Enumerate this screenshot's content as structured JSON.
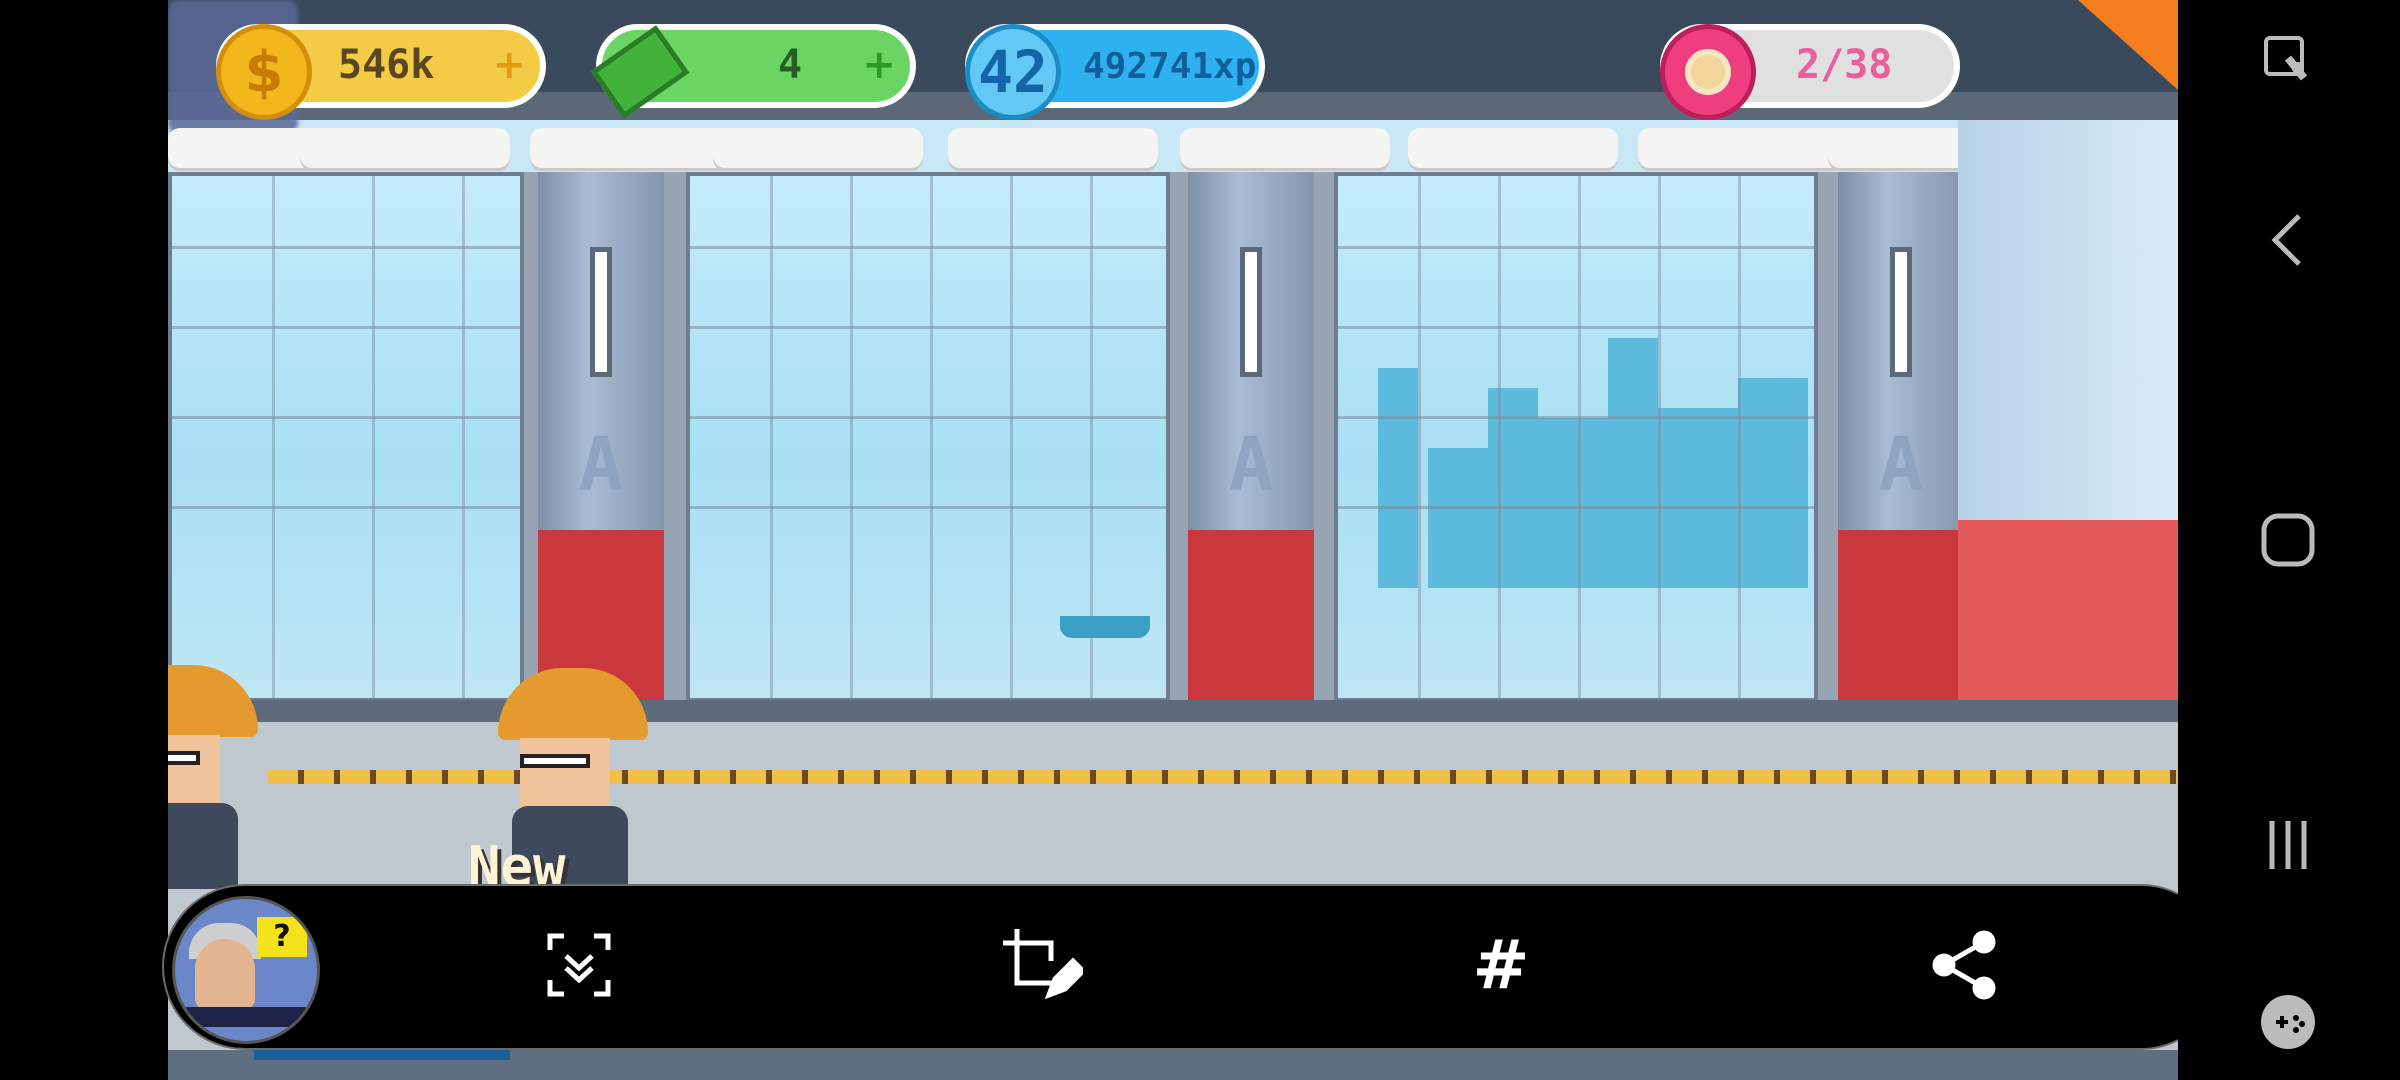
{
  "hud": {
    "coins": "546k",
    "cash": "4",
    "level": "42",
    "xp": "492741xp",
    "donuts": "2/38",
    "plus": "+"
  },
  "scene": {
    "pillar_letter": "A",
    "new_label": "New"
  },
  "thumbnail": {
    "badge": "?"
  },
  "toolbar": {
    "items": [
      "scroll-capture-icon",
      "crop-edit-icon",
      "hashtag-icon",
      "share-icon"
    ],
    "hashtag": "#"
  },
  "navbar": {
    "items": [
      "screen-record-icon",
      "back-icon",
      "home-icon",
      "recents-icon",
      "game-launcher-icon"
    ]
  },
  "colors": {
    "coins_bg": "#f4cb45",
    "cash_bg": "#6bd564",
    "xp_bg": "#2fb1f0",
    "donut_bg": "#e0e0e0",
    "pillar_red": "#c9383d"
  }
}
